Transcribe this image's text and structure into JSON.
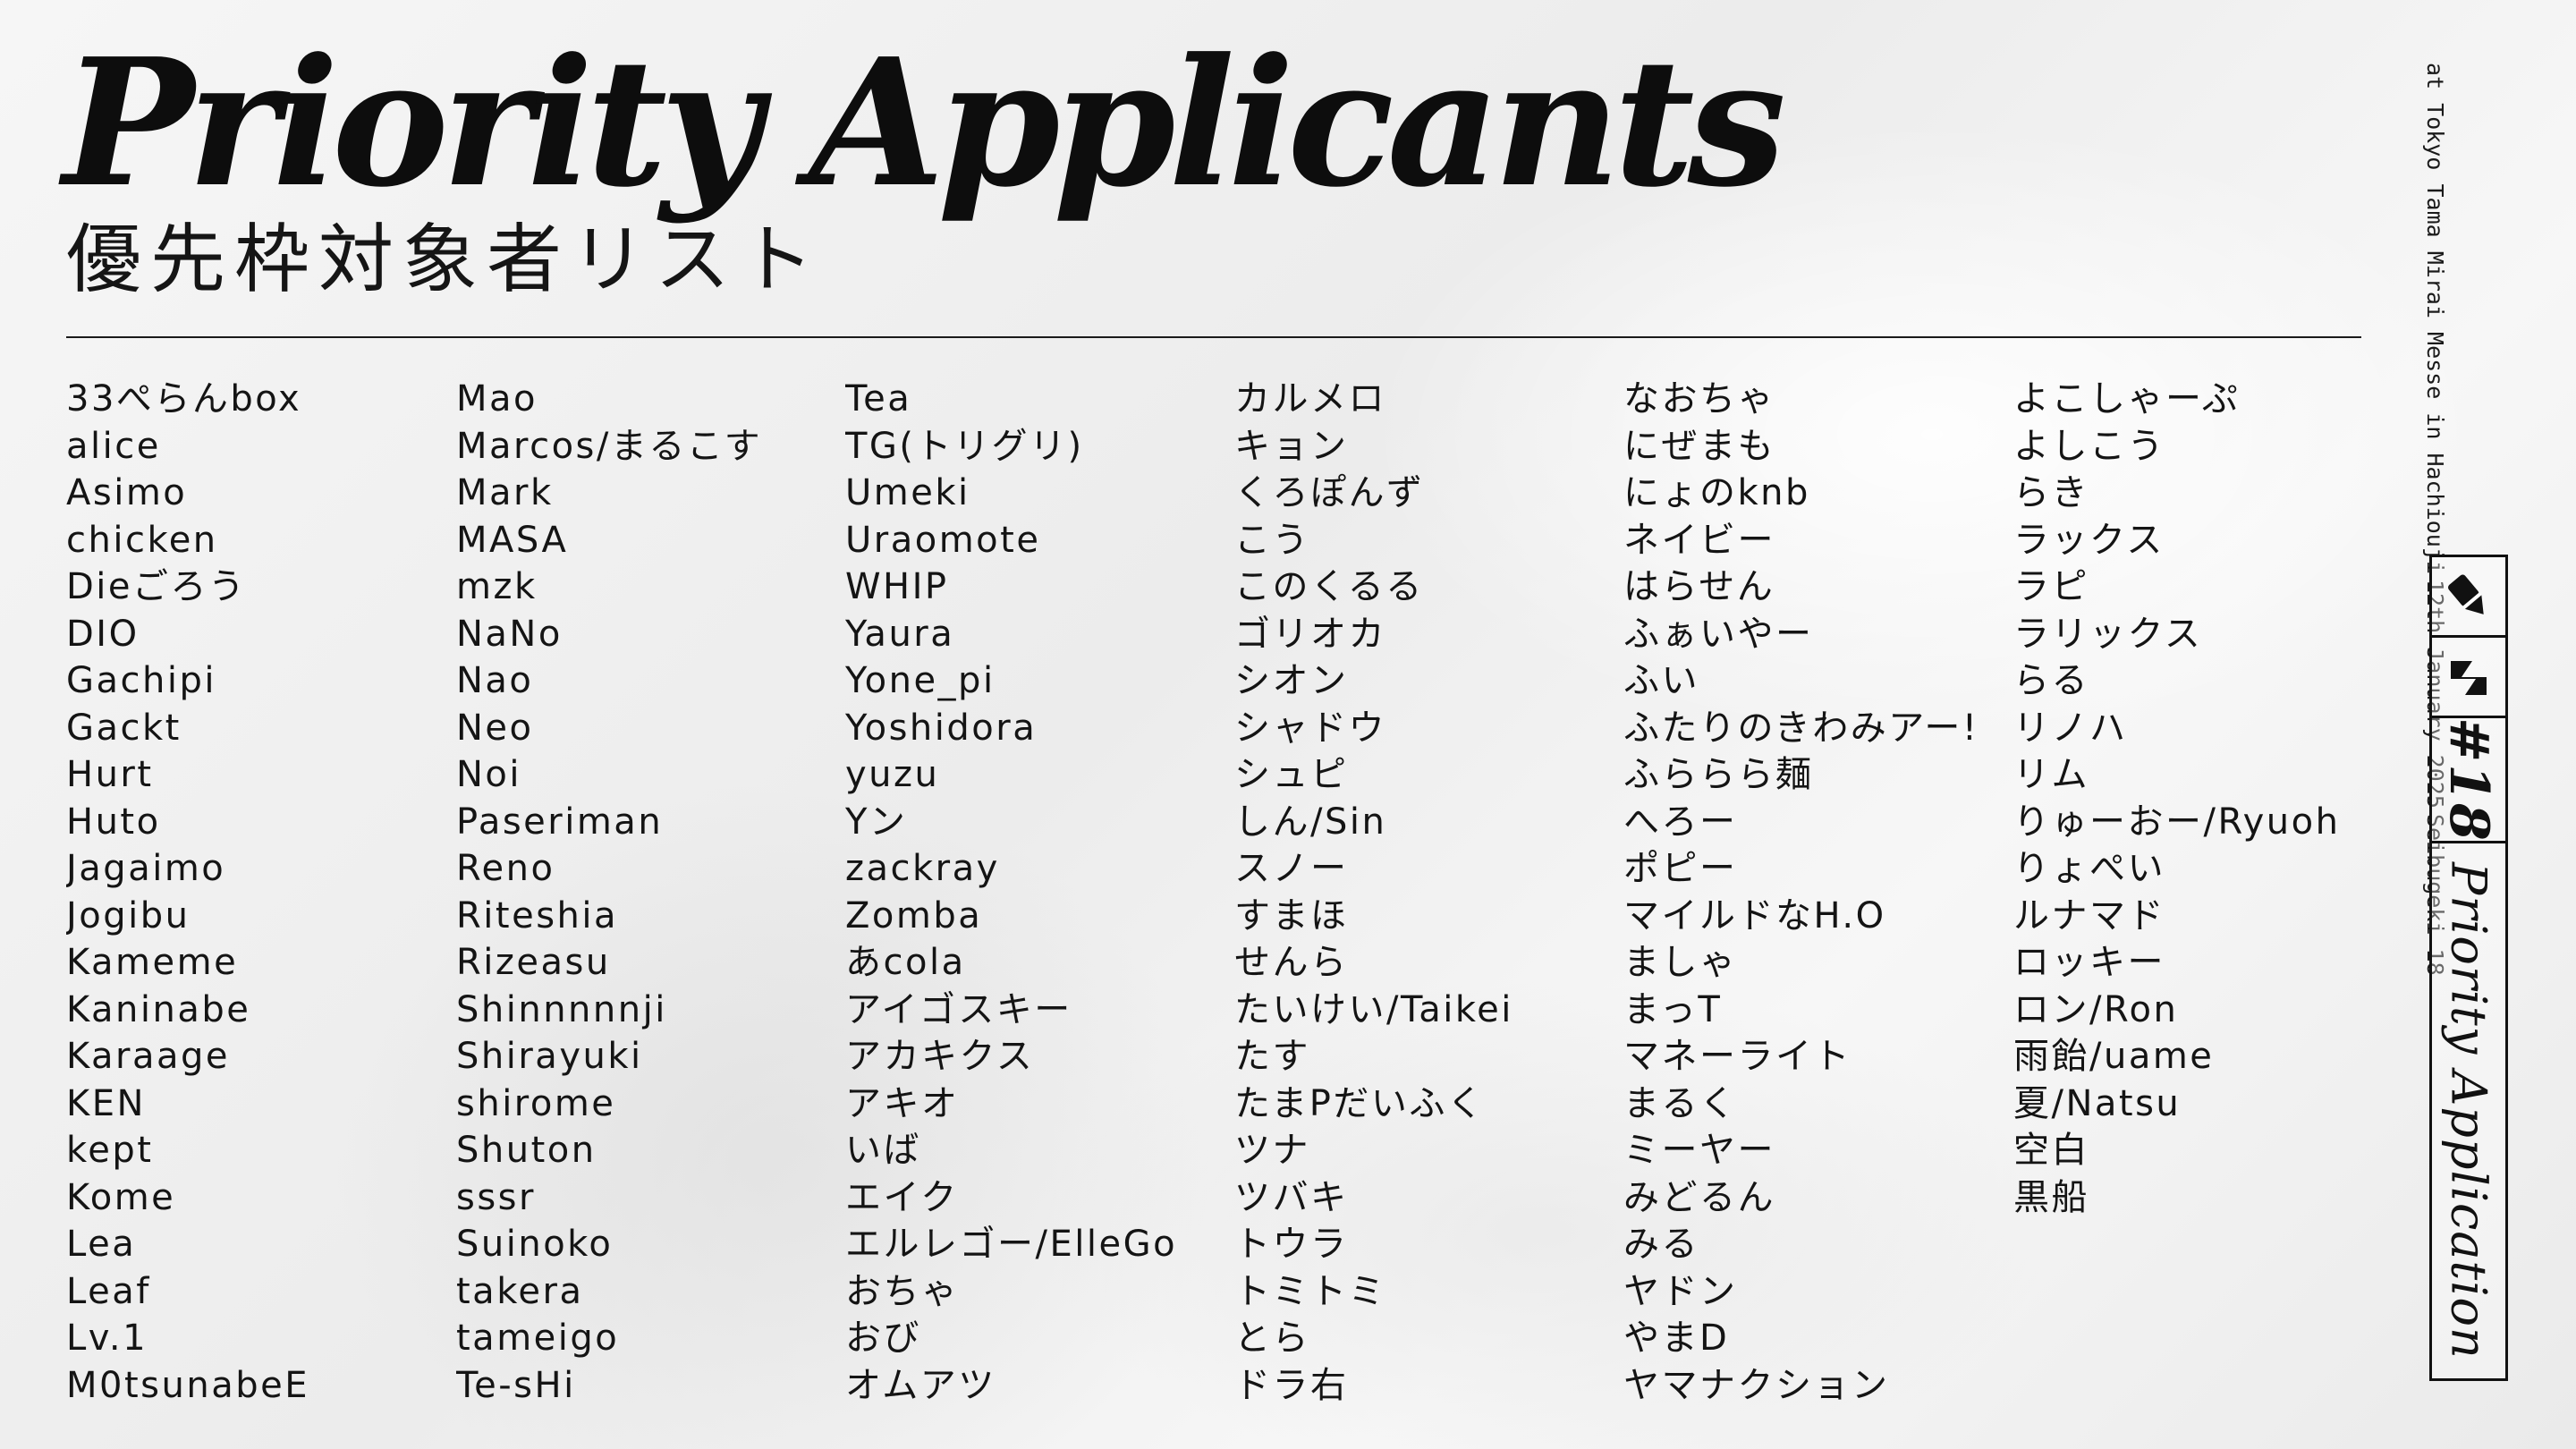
{
  "header": {
    "title": "Priority Applicants",
    "subtitle": "優先枠対象者リスト"
  },
  "event": {
    "name": "Seibugeki 18",
    "date": "12th January 2025",
    "venue": "at Tokyo Tama Mirai Messe in Hachiouji"
  },
  "badge": {
    "icon_top": "pen-nib-icon",
    "icon_logo": "s-logo-icon",
    "number": "#18",
    "label": "Priority Application"
  },
  "columns": [
    [
      "33ぺらんbox",
      "alice",
      "Asimo",
      "chicken",
      "Dieごろう",
      "DIO",
      "Gachipi",
      "Gackt",
      "Hurt",
      "Huto",
      "Jagaimo",
      "Jogibu",
      "Kameme",
      "Kaninabe",
      "Karaage",
      "KEN",
      "kept",
      "Kome",
      "Lea",
      "Leaf",
      "Lv.1",
      "M0tsunabeE"
    ],
    [
      "Mao",
      "Marcos/まるこす",
      "Mark",
      "MASA",
      "mzk",
      "NaNo",
      "Nao",
      "Neo",
      "Noi",
      "Paseriman",
      "Reno",
      "Riteshia",
      "Rizeasu",
      "Shinnnnnji",
      "Shirayuki",
      "shirome",
      "Shuton",
      "sssr",
      "Suinoko",
      "takera",
      "tameigo",
      "Te-sHi"
    ],
    [
      "Tea",
      "TG(トリグリ)",
      "Umeki",
      "Uraomote",
      "WHIP",
      "Yaura",
      "Yone_pi",
      "Yoshidora",
      "yuzu",
      "Yン",
      "zackray",
      "Zomba",
      "あcola",
      "アイゴスキー",
      "アカキクス",
      "アキオ",
      "いば",
      "エイク",
      "エルレゴー/ElleGo",
      "おちゃ",
      "おび",
      "オムアツ"
    ],
    [
      "カルメロ",
      "キョン",
      "くろぽんず",
      "こう",
      "このくるる",
      "ゴリオカ",
      "シオン",
      "シャドウ",
      "シュピ",
      "しん/Sin",
      "スノー",
      "すまほ",
      "せんら",
      "たいけい/Taikei",
      "たす",
      "たまPだいふく",
      "ツナ",
      "ツバキ",
      "トウラ",
      "トミトミ",
      "とら",
      "ドラ右"
    ],
    [
      "なおちゃ",
      "にぜまも",
      "にょのknb",
      "ネイビー",
      "はらせん",
      "ふぁいやー",
      "ふい",
      "ふたりのきわみアー!",
      "ふららら麺",
      "へろー",
      "ポピー",
      "マイルドなH.O",
      "ましゃ",
      "まっT",
      "マネーライト",
      "まるく",
      "ミーヤー",
      "みどるん",
      "みる",
      "ヤドン",
      "やまD",
      "ヤマナクション"
    ],
    [
      "よこしゃーぷ",
      "よしこう",
      "らき",
      "ラックス",
      "ラピ",
      "ラリックス",
      "らる",
      "リノハ",
      "リム",
      "りゅーおー/Ryuoh",
      "りょぺい",
      "ルナマド",
      "ロッキー",
      "ロン/Ron",
      "雨飴/uame",
      "夏/Natsu",
      "空白",
      "黒船"
    ]
  ]
}
